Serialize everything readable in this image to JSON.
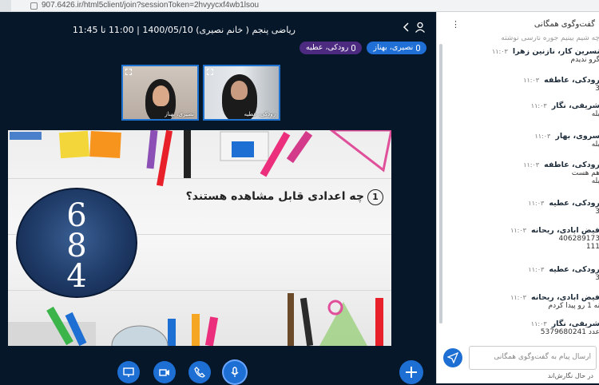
{
  "browser": {
    "url": "907.6426.ir/html5client/join?sessionToken=2hvyycxf4wb1lsou"
  },
  "meeting": {
    "title": "ریاضی پنجم ( خانم نصیری) 1400/05/10 | 11:00 تا 11:45"
  },
  "talkers": [
    {
      "name": "نصیری، بهناز",
      "color": "#1f6fd6"
    },
    {
      "name": "رودکی، عطیه",
      "color": "#4b2a80"
    }
  ],
  "videos": [
    {
      "name": "نصیری، بهناز"
    },
    {
      "name": "رودکی، عطیه"
    }
  ],
  "slide": {
    "question_number": "1",
    "question": "چه اعدادی قابل مشاهده هستند؟",
    "logo_line1": "6",
    "logo_line2": "8",
    "logo_line3": "4"
  },
  "chat": {
    "title": "گفت‌وگوی همگانی",
    "messages": [
      {
        "author": "",
        "time": "",
        "text": "چه شیم بینیم جوره نارسی نوشته"
      },
      {
        "author": "نسرین کار، نازنین زهرا",
        "time": "۱۱:۰۳",
        "text": "گرو ندیدم"
      },
      {
        "author": "رودکی، عاطفه",
        "time": "۱۱:۰۳",
        "text": "3"
      },
      {
        "author": "شریفی، نگار",
        "time": "۱۱:۰۳",
        "text": "بله"
      },
      {
        "author": "سروی، بهار",
        "time": "۱۱:۰۳",
        "text": "بله"
      },
      {
        "author": "رودکی، عاطفه",
        "time": "۱۱:۰۳",
        "text": "هم هست"
      },
      {
        "author": "",
        "time": "",
        "text": "بله"
      },
      {
        "author": "رودکی، عطیه",
        "time": "۱۱:۰۳",
        "text": "3"
      },
      {
        "author": "فیض ابادی، ریحانه",
        "time": "۱۱:۰۳",
        "text": "406289173"
      },
      {
        "author": "",
        "time": "",
        "text": "111"
      },
      {
        "author": "رودکی، عطیه",
        "time": "۱۱:۰۳",
        "text": "3"
      },
      {
        "author": "فیض ابادی، ریحانه",
        "time": "۱۱:۰۳",
        "text": "نه 1 رو پیدا کردم"
      },
      {
        "author": "شریفی، نگار",
        "time": "۱۱:۰۳",
        "text": "عدد 5379680241"
      }
    ],
    "input_placeholder": "ارسال پیام به گفت‌وگوی همگانی",
    "typing": "در حال نگارش‌اند"
  }
}
